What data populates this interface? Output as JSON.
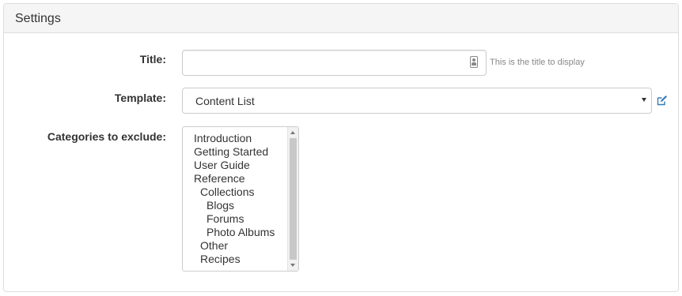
{
  "panel": {
    "heading": "Settings"
  },
  "form": {
    "title": {
      "label": "Title:",
      "value": "",
      "help": "This is the title to display",
      "icon": "contact-card-icon"
    },
    "template": {
      "label": "Template:",
      "selected": "Content List",
      "edit_icon": "edit-icon",
      "accent_color": "#337ab7"
    },
    "categories": {
      "label": "Categories to exclude:",
      "options": [
        {
          "label": "Introduction"
        },
        {
          "label": "Getting Started"
        },
        {
          "label": "User Guide"
        },
        {
          "label": "Reference"
        },
        {
          "label": "Collections"
        },
        {
          "label": "Blogs"
        },
        {
          "label": "Forums"
        },
        {
          "label": "Photo Albums"
        },
        {
          "label": "Other"
        },
        {
          "label": "Recipes"
        }
      ]
    }
  }
}
